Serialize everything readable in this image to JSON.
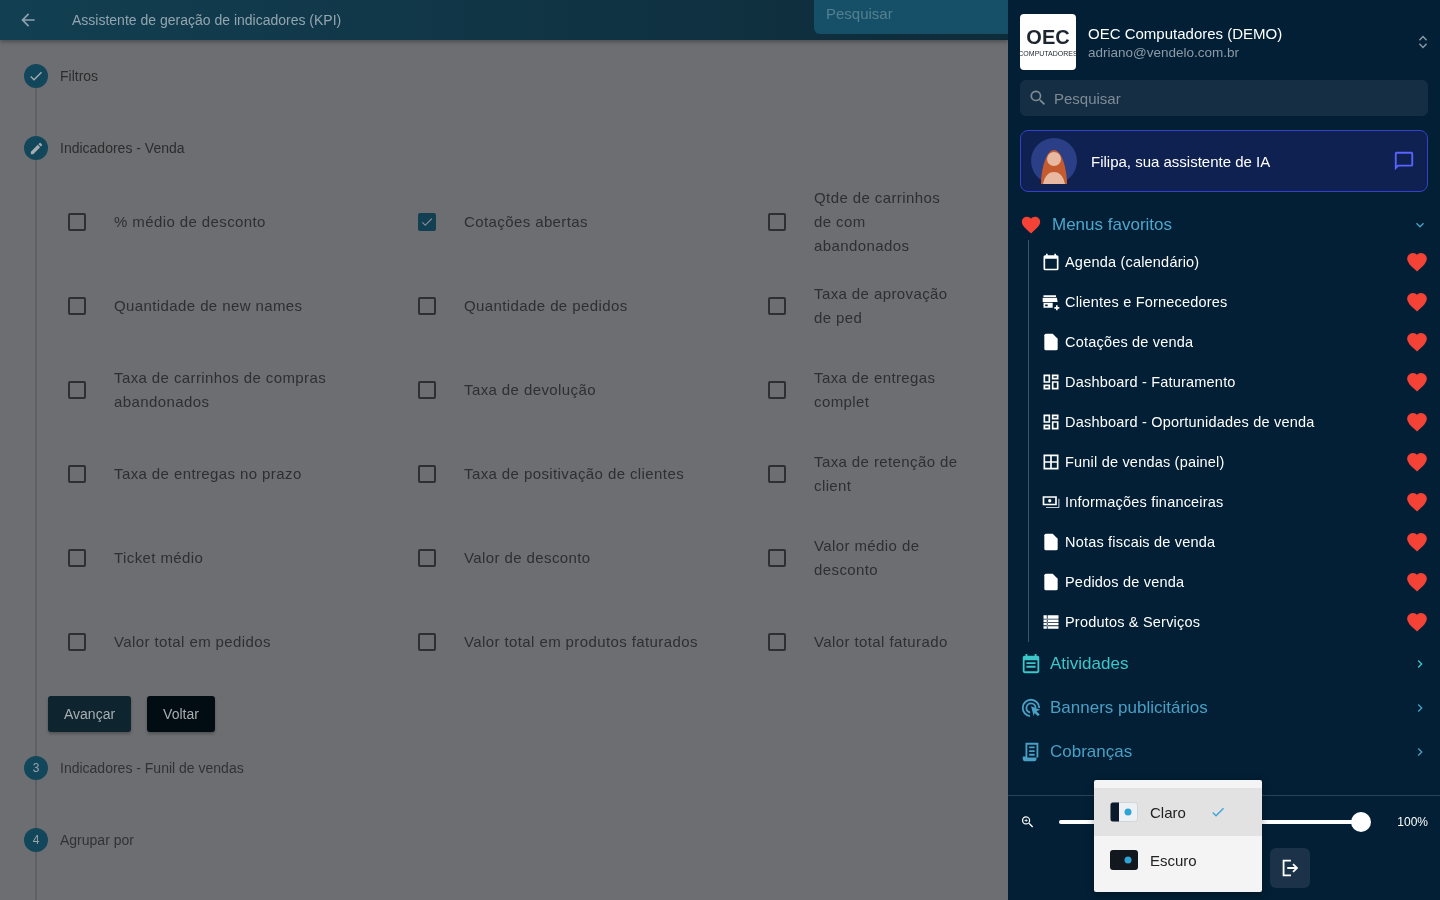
{
  "header": {
    "title": "Assistente de geração de indicadores (KPI)",
    "search": {
      "placeholder": "Pesquisar"
    }
  },
  "steps": [
    {
      "kind": "done",
      "label": "Filtros"
    },
    {
      "kind": "editing",
      "label": "Indicadores - Venda"
    },
    {
      "kind": "pending",
      "number": "3",
      "label": "Indicadores - Funil de vendas"
    },
    {
      "kind": "pending",
      "number": "4",
      "label": "Agrupar por"
    }
  ],
  "indicators": [
    {
      "label": "% médio de desconto",
      "checked": false
    },
    {
      "label": "Cotações abertas",
      "checked": true
    },
    {
      "label": "Qtde de carrinhos de com abandonados",
      "checked": false
    },
    {
      "label": "Quantidade de new names",
      "checked": false
    },
    {
      "label": "Quantidade de pedidos",
      "checked": false
    },
    {
      "label": "Taxa de aprovação de ped",
      "checked": false
    },
    {
      "label": "Taxa de carrinhos de compras abandonados",
      "checked": false
    },
    {
      "label": "Taxa de devolução",
      "checked": false
    },
    {
      "label": "Taxa de entregas complet",
      "checked": false
    },
    {
      "label": "Taxa de entregas no prazo",
      "checked": false
    },
    {
      "label": "Taxa de positivação de clientes",
      "checked": false
    },
    {
      "label": "Taxa de retenção de client",
      "checked": false
    },
    {
      "label": "Ticket médio",
      "checked": false
    },
    {
      "label": "Valor de desconto",
      "checked": false
    },
    {
      "label": "Valor médio de desconto",
      "checked": false
    },
    {
      "label": "Valor total em pedidos",
      "checked": false
    },
    {
      "label": "Valor total em produtos faturados",
      "checked": false
    },
    {
      "label": "Valor total faturado",
      "checked": false
    }
  ],
  "buttons": {
    "next": "Avançar",
    "back": "Voltar"
  },
  "sidebar": {
    "company": "OEC Computadores (DEMO)",
    "email": "adriano@vendelo.com.br",
    "logo": {
      "text": "OEC",
      "subtext": "COMPUTADORES"
    },
    "search": {
      "placeholder": "Pesquisar"
    },
    "assistant": {
      "label": "Filipa, sua assistente de IA"
    },
    "favorites": {
      "title": "Menus favoritos",
      "expanded": true,
      "items": [
        {
          "kind": "calendar",
          "label": "Agenda (calendário)",
          "favorite": true
        },
        {
          "kind": "store",
          "label": "Clientes e Fornecedores",
          "favorite": true
        },
        {
          "kind": "document",
          "label": "Cotações de venda",
          "favorite": true
        },
        {
          "kind": "dashboard",
          "label": "Dashboard -  Faturamento",
          "favorite": true
        },
        {
          "kind": "dashboard",
          "label": "Dashboard -  Oportunidades de venda",
          "favorite": true
        },
        {
          "kind": "grid",
          "label": "Funil de vendas (painel)",
          "favorite": true
        },
        {
          "kind": "money",
          "label": "Informações financeiras",
          "favorite": true
        },
        {
          "kind": "document",
          "label": "Notas fiscais de venda",
          "favorite": true
        },
        {
          "kind": "document",
          "label": "Pedidos de venda",
          "favorite": true
        },
        {
          "kind": "table",
          "label": "Produtos & Serviços",
          "favorite": true
        }
      ]
    },
    "sections": [
      {
        "kind": "activities",
        "label": "Atividades",
        "color": "#3cc6c9"
      },
      {
        "kind": "banners",
        "label": "Banners publicitários",
        "color": "#4b9fc4"
      },
      {
        "kind": "billing",
        "label": "Cobranças",
        "color": "#4b9fc4"
      }
    ],
    "zoom": {
      "level": 1,
      "reading": "100%"
    },
    "theme_menu": [
      {
        "kind": "light",
        "label": "Claro",
        "selected": true
      },
      {
        "kind": "dark",
        "label": "Escuro",
        "selected": false
      }
    ]
  }
}
